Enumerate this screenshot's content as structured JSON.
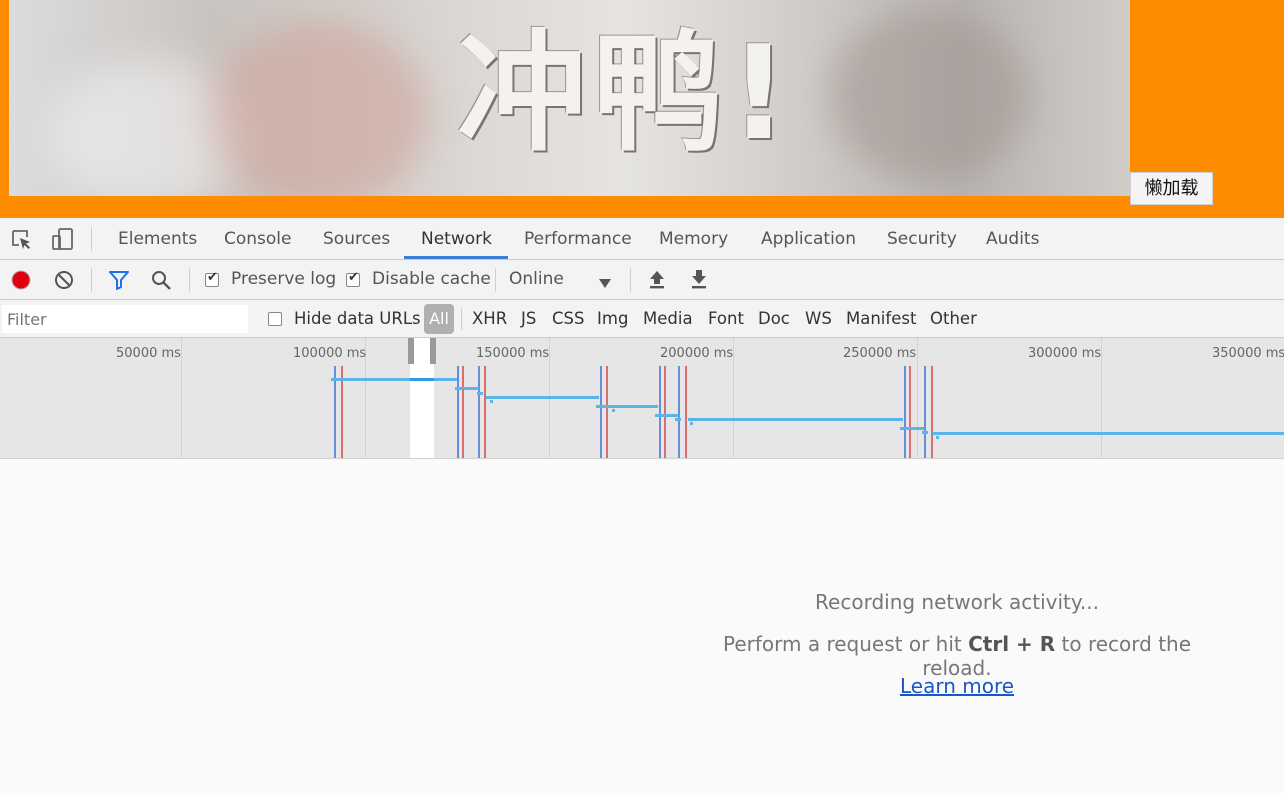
{
  "page": {
    "meme_text": "冲鸭!",
    "lazy_button": "懒加载",
    "bg_color": "#ff8c00"
  },
  "devtools": {
    "tabs": [
      {
        "label": "Elements"
      },
      {
        "label": "Console"
      },
      {
        "label": "Sources"
      },
      {
        "label": "Network",
        "active": true
      },
      {
        "label": "Performance"
      },
      {
        "label": "Memory"
      },
      {
        "label": "Application"
      },
      {
        "label": "Security"
      },
      {
        "label": "Audits"
      }
    ],
    "icons": {
      "inspect": "inspect-element-icon",
      "device": "device-toolbar-icon",
      "record": "record-icon",
      "clear": "clear-icon",
      "filter": "filter-icon",
      "search": "search-icon",
      "throttle_dropdown": "dropdown-arrow-icon",
      "import": "import-har-icon",
      "export": "export-har-icon"
    },
    "toolbar": {
      "preserve_log": {
        "label": "Preserve log",
        "checked": true
      },
      "disable_cache": {
        "label": "Disable cache",
        "checked": true
      },
      "throttling": "Online"
    },
    "filter": {
      "placeholder": "Filter",
      "hide_data_urls": {
        "label": "Hide data URLs",
        "checked": false
      },
      "types": [
        "All",
        "XHR",
        "JS",
        "CSS",
        "Img",
        "Media",
        "Font",
        "Doc",
        "WS",
        "Manifest",
        "Other"
      ],
      "active_type": "All"
    },
    "overview": {
      "ticks": [
        "50000 ms",
        "100000 ms",
        "150000 ms",
        "200000 ms",
        "250000 ms",
        "300000 ms",
        "350000 ms"
      ],
      "colors": {
        "waterfall": "#5bb3e6",
        "dom_content_loaded": "#3b6fd6",
        "load": "#d64545"
      }
    },
    "empty_state": {
      "line1": "Recording network activity...",
      "line2_prefix": "Perform a request or hit ",
      "line2_key1": "Ctrl",
      "line2_plus": " + ",
      "line2_key2": "R",
      "line2_suffix": " to record the reload.",
      "learn_more": "Learn more"
    }
  }
}
